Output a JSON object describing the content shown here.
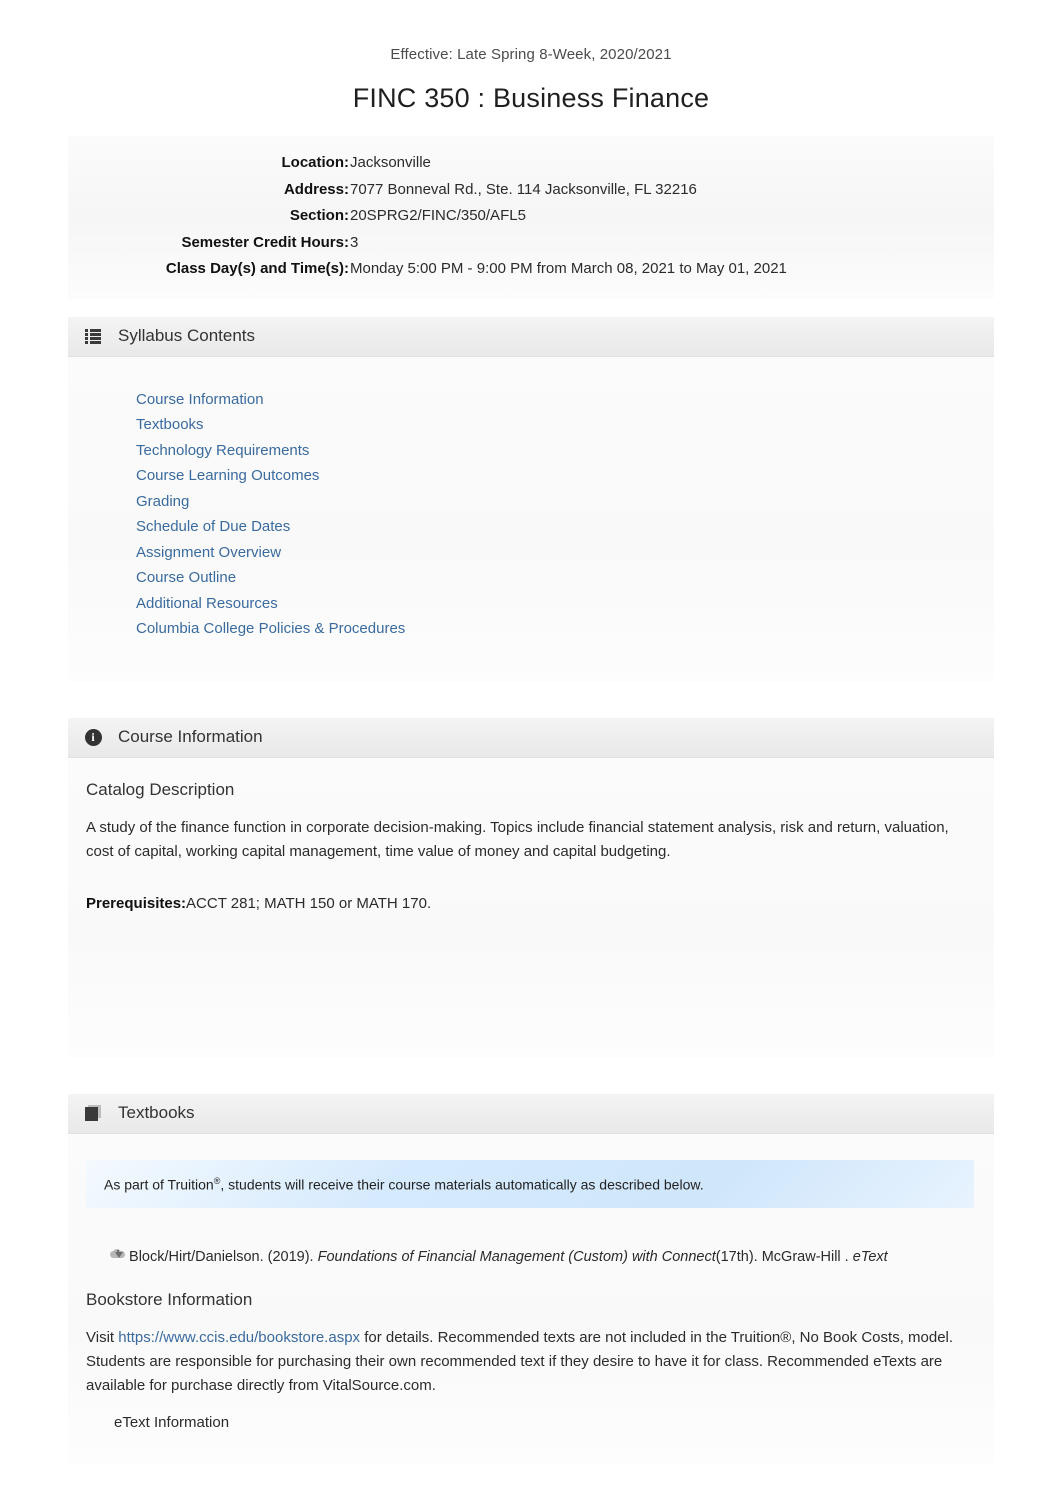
{
  "header": {
    "effective": "Effective: Late Spring 8-Week, 2020/2021",
    "title": "FINC 350 : Business Finance"
  },
  "details": [
    {
      "label": "Location:",
      "value": "Jacksonville"
    },
    {
      "label": "Address:",
      "value": "7077 Bonneval Rd., Ste. 114 Jacksonville, FL 32216"
    },
    {
      "label": "Section:",
      "value": "20SPRG2/FINC/350/AFL5"
    },
    {
      "label": "Semester Credit Hours:",
      "value": "3"
    },
    {
      "label": "Class Day(s) and Time(s):",
      "value": "Monday 5:00 PM - 9:00 PM from March 08, 2021 to May 01, 2021"
    }
  ],
  "syllabus_contents": {
    "heading": "Syllabus Contents",
    "icon": "list-icon",
    "links": [
      "Course Information",
      "Textbooks",
      "Technology Requirements",
      "Course Learning Outcomes",
      "Grading",
      "Schedule of Due Dates",
      "Assignment Overview",
      "Course Outline",
      "Additional Resources",
      "Columbia College Policies & Procedures"
    ]
  },
  "course_information": {
    "heading": "Course Information",
    "icon": "info-circle-icon",
    "catalog_heading": "Catalog Description",
    "catalog_text": "A study of the finance function in corporate decision-making. Topics include financial statement analysis, risk and return, valuation, cost of capital, working capital management, time value of money and capital budgeting.",
    "prerequisites_label": "Prerequisites:",
    "prerequisites_value": "ACCT 281; MATH 150 or MATH 170."
  },
  "textbooks": {
    "heading": "Textbooks",
    "icon": "book-icon",
    "alert_prefix": "As part of Truition",
    "alert_sup": "®",
    "alert_suffix": ", students will receive their course materials automatically as described below.",
    "citation": {
      "icon": "cloud-download-icon",
      "authors_year": "Block/Hirt/Danielson. (2019).",
      "work_italic": "Foundations of Financial Management (Custom) with Connect",
      "edition": "(17th). McGraw-Hill .",
      "format_italic": "eText"
    },
    "bookstore_heading": "Bookstore Information",
    "bookstore_visit": "Visit",
    "bookstore_link": "https://www.ccis.edu/bookstore.aspx",
    "bookstore_text": "for details. Recommended texts are not included in the Truition®, No Book Costs, model. Students are responsible for purchasing their own recommended text if they desire to have it for class. Recommended eTexts are available for purchase directly from VitalSource.com.",
    "etext_info": "eText Information"
  },
  "colors": {
    "link": "#3a6b9e",
    "alert_blue": "#cfe6fb",
    "panel_gray": "#f8f8f8",
    "text": "#2b2b2b"
  }
}
